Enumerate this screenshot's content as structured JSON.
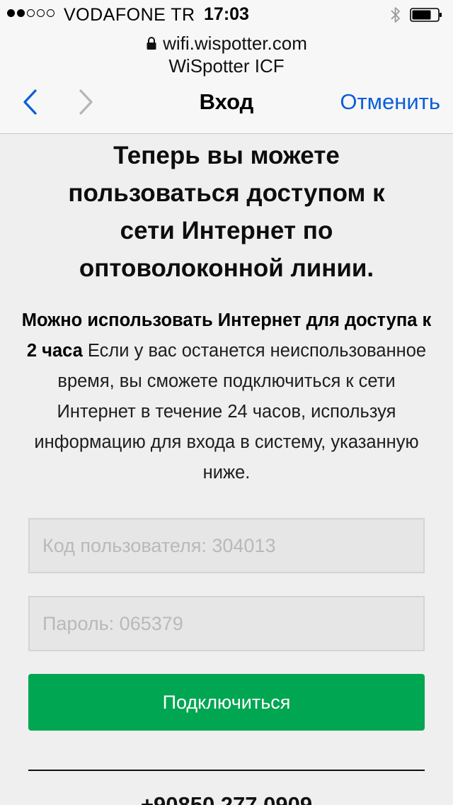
{
  "status_bar": {
    "carrier": "VODAFONE TR",
    "time": "17:03",
    "signal_strength_bars": 2,
    "signal_total_bars": 5
  },
  "browser": {
    "url": "wifi.wispotter.com",
    "site_title": "WiSpotter ICF",
    "nav_title": "Вход",
    "cancel_label": "Отменить",
    "accent_color": "#0a5fd6"
  },
  "content": {
    "headline": "Теперь вы можете пользоваться доступом к сети Интернет по оптоволоконной линии.",
    "body_bold": "Можно использовать Интернет для доступа к 2 часа",
    "body_rest": " Если у вас останется неиспользованное время, вы сможете подключиться к сети Интернет в течение 24 часов, используя информацию для входа в систему, указанную ниже."
  },
  "form": {
    "user_code_placeholder": "Код пользователя: 304013",
    "password_placeholder": "Пароль: 065379",
    "connect_label": "Подключиться",
    "connect_color": "#00a651"
  },
  "footer": {
    "phone": "+90850 277 0909"
  },
  "icons": [
    "lock-icon",
    "bluetooth-icon",
    "battery-icon",
    "back-arrow-icon",
    "forward-arrow-icon"
  ]
}
